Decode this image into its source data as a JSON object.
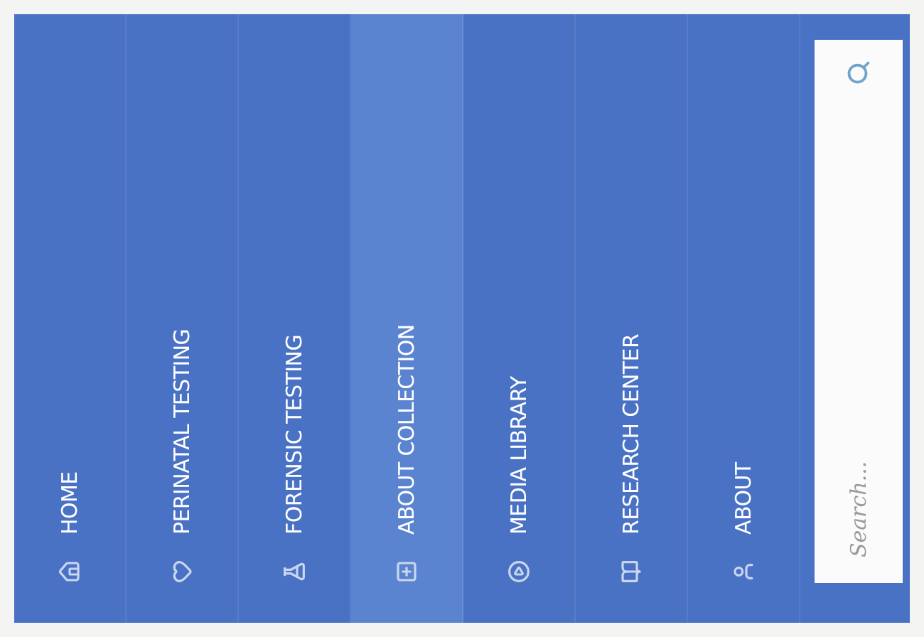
{
  "menu": {
    "items": [
      {
        "label": "HOME",
        "selected": false
      },
      {
        "label": "PERINATAL TESTING",
        "selected": false
      },
      {
        "label": "FORENSIC TESTING",
        "selected": false
      },
      {
        "label": "ABOUT COLLECTION",
        "selected": true
      },
      {
        "label": "MEDIA LIBRARY",
        "selected": false
      },
      {
        "label": "RESEARCH CENTER",
        "selected": false
      },
      {
        "label": "ABOUT",
        "selected": false
      }
    ]
  },
  "search": {
    "placeholder": "Search..."
  }
}
